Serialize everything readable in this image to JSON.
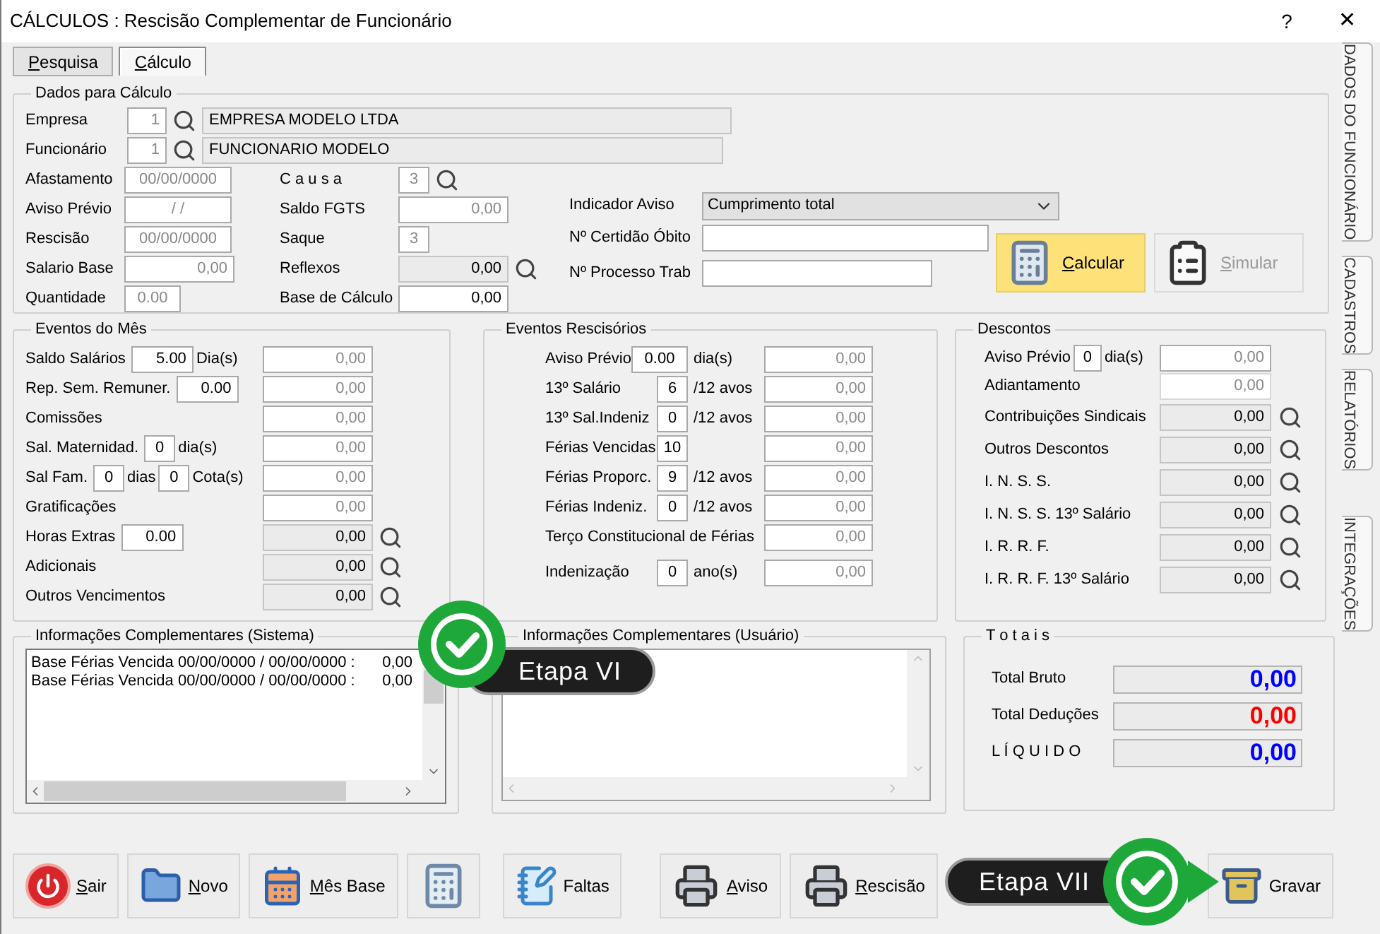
{
  "window": {
    "title": "CÁLCULOS : Rescisão Complementar de Funcionário",
    "help": "?",
    "close": "✕"
  },
  "tabs": [
    {
      "label": "Pesquisa",
      "selected": false,
      "mnemonic": true
    },
    {
      "label": "Cálculo",
      "selected": true,
      "mnemonic": true
    }
  ],
  "dados": {
    "title": "Dados para Cálculo",
    "empresa": {
      "label": "Empresa",
      "code": "1",
      "name": "EMPRESA MODELO LTDA"
    },
    "funcionario": {
      "label": "Funcionário",
      "code": "1",
      "name": "FUNCIONARIO MODELO"
    },
    "left": [
      {
        "label": "Afastamento",
        "value": "00/00/0000",
        "kind": "date",
        "disabled": true,
        "readonly": false,
        "lookup": false
      },
      {
        "label": "Aviso Prévio",
        "value": "/ /",
        "kind": "date",
        "disabled": true,
        "readonly": false,
        "lookup": false
      },
      {
        "label": "Rescisão",
        "value": "00/00/0000",
        "kind": "date",
        "disabled": true,
        "readonly": false,
        "lookup": false
      },
      {
        "label": "Salario Base",
        "value": "0,00",
        "kind": "number",
        "disabled": true,
        "readonly": false,
        "lookup": false
      },
      {
        "label": "Quantidade",
        "value": "0.00",
        "kind": "qty",
        "disabled": true,
        "readonly": false,
        "lookup": false
      }
    ],
    "middle": [
      {
        "label": "C a u s a",
        "value": "3",
        "kind": "code",
        "disabled": true,
        "readonly": false,
        "lookup": true
      },
      {
        "label": "Saldo FGTS",
        "value": "0,00",
        "kind": "number",
        "disabled": true,
        "readonly": false,
        "lookup": false
      },
      {
        "label": "Saque",
        "value": "3",
        "kind": "code",
        "disabled": true,
        "readonly": false,
        "lookup": false
      },
      {
        "label": "Reflexos",
        "value": "0,00",
        "kind": "number",
        "disabled": false,
        "readonly": true,
        "lookup": true
      },
      {
        "label": "Base de Cálculo",
        "value": "0,00",
        "kind": "number",
        "disabled": false,
        "readonly": false,
        "lookup": false
      }
    ],
    "indicador": {
      "label": "Indicador Aviso",
      "value": "Cumprimento total"
    },
    "certidao": {
      "label": "Nº Certidão Óbito"
    },
    "processo": {
      "label": "Nº Processo Trab"
    },
    "actions": [
      {
        "label": "Calcular",
        "kind": "calculate",
        "disabled": false,
        "mnemonic": true
      },
      {
        "label": "Simular",
        "kind": "simulate",
        "disabled": true,
        "mnemonic": true
      }
    ]
  },
  "eventos_mes": {
    "title": "Eventos do Mês",
    "rows": [
      {
        "label": "Saldo Salários",
        "inputs": [
          {
            "kind": "decimal",
            "value": "5.00",
            "unit": "Dia(s)"
          }
        ],
        "amount": "0,00",
        "readonly": false,
        "lookup": false
      },
      {
        "label": "Rep. Sem. Remuner.",
        "inputs": [
          {
            "kind": "decimal",
            "value": "0.00"
          }
        ],
        "amount": "0,00",
        "readonly": false,
        "lookup": false
      },
      {
        "label": "Comissões",
        "amount": "0,00",
        "readonly": false,
        "lookup": false
      },
      {
        "label": "Sal. Maternidad.",
        "inputs": [
          {
            "kind": "count",
            "value": "0",
            "unit": "dia(s)"
          }
        ],
        "amount": "0,00",
        "readonly": false,
        "lookup": false
      },
      {
        "label": "Sal Fam.",
        "inputs": [
          {
            "kind": "count",
            "value": "0",
            "unit": "dias"
          },
          {
            "kind": "count",
            "value": "0",
            "unit": "Cota(s)"
          }
        ],
        "amount": "0,00",
        "readonly": false,
        "lookup": false
      },
      {
        "label": "Gratificações",
        "amount": "0,00",
        "readonly": false,
        "lookup": false
      },
      {
        "label": "Horas Extras",
        "inputs": [
          {
            "kind": "decimal",
            "value": "0.00"
          }
        ],
        "amount": "0,00",
        "readonly": true,
        "lookup": true
      },
      {
        "label": "Adicionais",
        "amount": "0,00",
        "readonly": true,
        "lookup": true
      },
      {
        "label": "Outros Vencimentos",
        "amount": "0,00",
        "readonly": true,
        "lookup": true
      }
    ]
  },
  "eventos_rescisorios": {
    "title": "Eventos Rescisórios",
    "rows": [
      {
        "label": "Aviso Prévio",
        "input": {
          "kind": "decimal",
          "value": "0.00"
        },
        "unit": "dia(s)",
        "amount": "0,00"
      },
      {
        "label": "13º Salário",
        "input": {
          "kind": "count",
          "value": "6"
        },
        "unit": "/12 avos",
        "amount": "0,00"
      },
      {
        "label": "13º Sal.Indeniz",
        "input": {
          "kind": "count",
          "value": "0"
        },
        "unit": "/12 avos",
        "amount": "0,00"
      },
      {
        "label": "Férias Vencidas",
        "input": {
          "kind": "count",
          "value": "10"
        },
        "amount": "0,00"
      },
      {
        "label": "Férias Proporc.",
        "input": {
          "kind": "count",
          "value": "9"
        },
        "unit": "/12 avos",
        "amount": "0,00"
      },
      {
        "label": "Férias Indeniz.",
        "input": {
          "kind": "count",
          "value": "0"
        },
        "unit": "/12 avos",
        "amount": "0,00"
      },
      {
        "label": "Terço Constitucional de Férias",
        "amount": "0,00"
      },
      {
        "label": "Indenização",
        "input": {
          "kind": "count",
          "value": "0"
        },
        "unit": "ano(s)",
        "amount": "0,00"
      }
    ]
  },
  "descontos": {
    "title": "Descontos",
    "rows": [
      {
        "label": "Aviso Prévio",
        "input": {
          "value": "0",
          "unit": "dia(s)"
        },
        "amount": "0,00",
        "readonly": false,
        "disabled": false,
        "lookup": false
      },
      {
        "label": "Adiantamento",
        "amount": "0,00",
        "readonly": false,
        "disabled": true,
        "lookup": false
      },
      {
        "label": "Contribuições Sindicais",
        "amount": "0,00",
        "readonly": true,
        "disabled": false,
        "lookup": true
      },
      {
        "label": "Outros Descontos",
        "amount": "0,00",
        "readonly": true,
        "disabled": false,
        "lookup": true
      },
      {
        "label": "I. N. S. S.",
        "amount": "0,00",
        "readonly": true,
        "disabled": false,
        "lookup": true
      },
      {
        "label": "I. N. S. S.  13º Salário",
        "amount": "0,00",
        "readonly": true,
        "disabled": false,
        "lookup": true
      },
      {
        "label": "I. R. R. F.",
        "amount": "0,00",
        "readonly": true,
        "disabled": false,
        "lookup": true
      },
      {
        "label": "I. R. R. F.  13º Salário",
        "amount": "0,00",
        "readonly": true,
        "disabled": false,
        "lookup": true
      }
    ]
  },
  "info_sistema": {
    "title": "Informações Complementares (Sistema)",
    "lines": [
      {
        "text": "Base Férias Vencida 00/00/0000 / 00/00/0000 :",
        "value": "0,00"
      },
      {
        "text": "Base Férias Vencida 00/00/0000 / 00/00/0000 :",
        "value": "0,00"
      }
    ]
  },
  "info_usuario": {
    "title": "Informações Complementares (Usuário)"
  },
  "totais": {
    "title": "T o t a i s",
    "rows": [
      {
        "label": "Total  Bruto",
        "value": "0,00",
        "color": "#0000ff"
      },
      {
        "label": "Total  Deduções",
        "value": "0,00",
        "color": "#ff0000"
      },
      {
        "label": "L Í Q U I D O",
        "value": "0,00",
        "color": "#0000ff"
      }
    ]
  },
  "toolbar": [
    [
      {
        "label": "Sair",
        "kind": "exit",
        "mnemonic": true
      },
      {
        "label": "Novo",
        "kind": "new",
        "mnemonic": true
      },
      {
        "label": "Mês Base",
        "kind": "month",
        "mnemonic": true
      },
      {
        "kind": "calculator"
      }
    ],
    [
      {
        "label": "Faltas",
        "kind": "absences",
        "mnemonic": false
      }
    ],
    [
      {
        "label": "Aviso",
        "kind": "print",
        "mnemonic": true
      },
      {
        "label": "Rescisão",
        "kind": "print",
        "mnemonic": true
      }
    ],
    [
      {
        "label": "Gravar",
        "kind": "save",
        "mnemonic": false
      }
    ]
  ],
  "side_tabs": [
    {
      "label": "DADOS DO FUNCIONÁRIO"
    },
    {
      "label": "CADASTROS"
    },
    {
      "label": "RELATÓRIOS"
    },
    {
      "label": "INTEGRAÇÕES"
    }
  ],
  "callouts": [
    {
      "label": "Etapa VI",
      "kind": "circle-left"
    },
    {
      "label": "Etapa VII",
      "kind": "circle-right"
    }
  ]
}
